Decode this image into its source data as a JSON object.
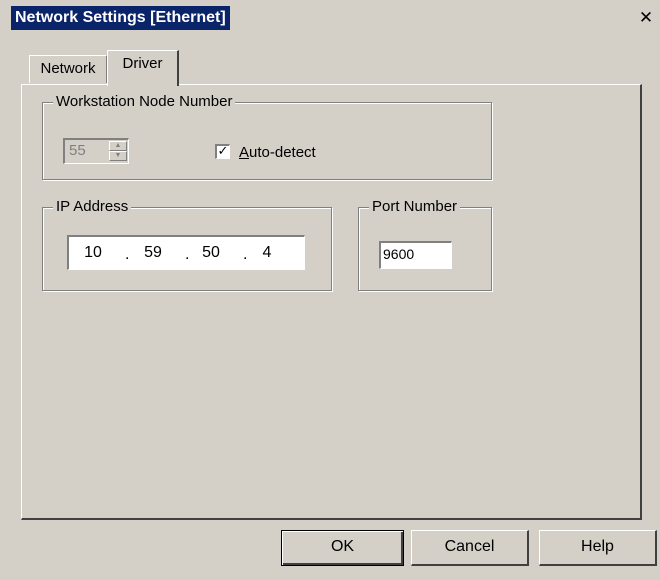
{
  "window": {
    "title": "Network Settings [Ethernet]",
    "close_label": "✕"
  },
  "tabs": [
    {
      "label": "Network",
      "selected": false
    },
    {
      "label": "Driver",
      "selected": true
    }
  ],
  "node_group": {
    "legend": "Workstation Node Number",
    "node_number": "55",
    "node_number_enabled": false,
    "auto_detect": {
      "label_prefix": "A",
      "label_rest": "uto-detect",
      "checked": true
    }
  },
  "ip_group": {
    "legend": "IP Address",
    "octets": [
      "10",
      "59",
      "50",
      "4"
    ],
    "separator": "."
  },
  "port_group": {
    "legend": "Port Number",
    "port": "9600"
  },
  "buttons": {
    "ok": "OK",
    "cancel": "Cancel",
    "help": "Help"
  },
  "colors": {
    "face": "#d4d0c8",
    "title_bg": "#0a246a",
    "title_fg": "#ffffff",
    "field_bg": "#ffffff"
  }
}
